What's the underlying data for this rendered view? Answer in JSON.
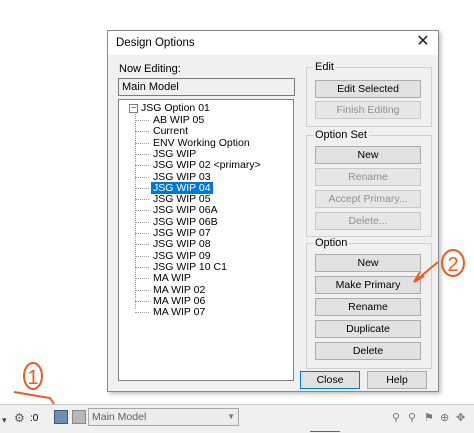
{
  "dialog": {
    "title": "Design Options",
    "now_editing_label": "Now Editing:",
    "now_editing_value": "Main Model",
    "tree": {
      "root": "JSG Option 01",
      "items": [
        "AB WIP 05",
        "Current",
        "ENV Working Option",
        "JSG WIP",
        "JSG WIP 02  <primary>",
        "JSG WIP 03",
        "JSG WIP 04",
        "JSG WIP 05",
        "JSG WIP 06A",
        "JSG WIP 06B",
        "JSG WIP 07",
        "JSG WIP 08",
        "JSG WIP 09",
        "JSG WIP 10 C1",
        "MA WIP",
        "MA WIP 02",
        "MA WIP 06",
        "MA WIP 07"
      ],
      "selected": "JSG WIP 04"
    },
    "edit_group": {
      "label": "Edit",
      "edit_selected": "Edit Selected",
      "finish_editing": "Finish Editing"
    },
    "option_set_group": {
      "label": "Option Set",
      "new": "New",
      "rename": "Rename",
      "accept_primary": "Accept Primary...",
      "delete": "Delete..."
    },
    "option_group": {
      "label": "Option",
      "new": "New",
      "make_primary": "Make Primary",
      "rename": "Rename",
      "duplicate": "Duplicate",
      "delete": "Delete"
    },
    "close": "Close",
    "help": "Help"
  },
  "taskbar": {
    "worksets_value": ":0",
    "design_option_value": "Main Model"
  },
  "annotations": {
    "one": "1",
    "two": "2",
    "color": "#f05a22"
  }
}
